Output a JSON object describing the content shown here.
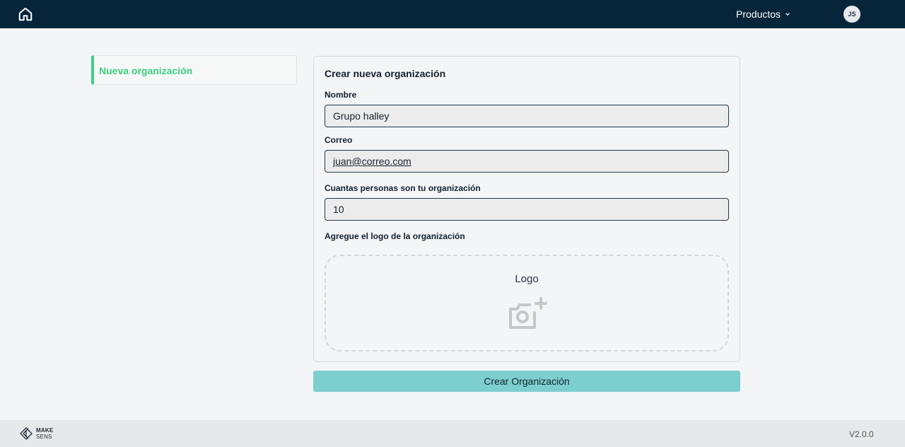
{
  "header": {
    "products_label": "Productos",
    "avatar_initials": "JS"
  },
  "sidebar": {
    "items": [
      {
        "label": "Nueva organización",
        "active": true
      }
    ]
  },
  "form": {
    "title": "Crear nueva organización",
    "name_label": "Nombre",
    "name_value": "Grupo halley",
    "email_label": "Correo",
    "email_value": "juan@correo.com",
    "size_label": "Cuantas personas son tu organización",
    "size_value": "10",
    "logo_label": "Agregue el logo de la organización",
    "logo_dropzone_label": "Logo",
    "submit_label": "Crear Organización"
  },
  "footer": {
    "logo_line1": "MAKE",
    "logo_line2": "SENS",
    "version": "V2.0.0"
  },
  "colors": {
    "topbar": "#06253a",
    "accent_green": "#3ccf7e",
    "button_teal": "#7dcfcf",
    "background": "#f3f5f7"
  },
  "icons": [
    "home-icon",
    "chevron-down-icon",
    "camera-add-icon"
  ]
}
